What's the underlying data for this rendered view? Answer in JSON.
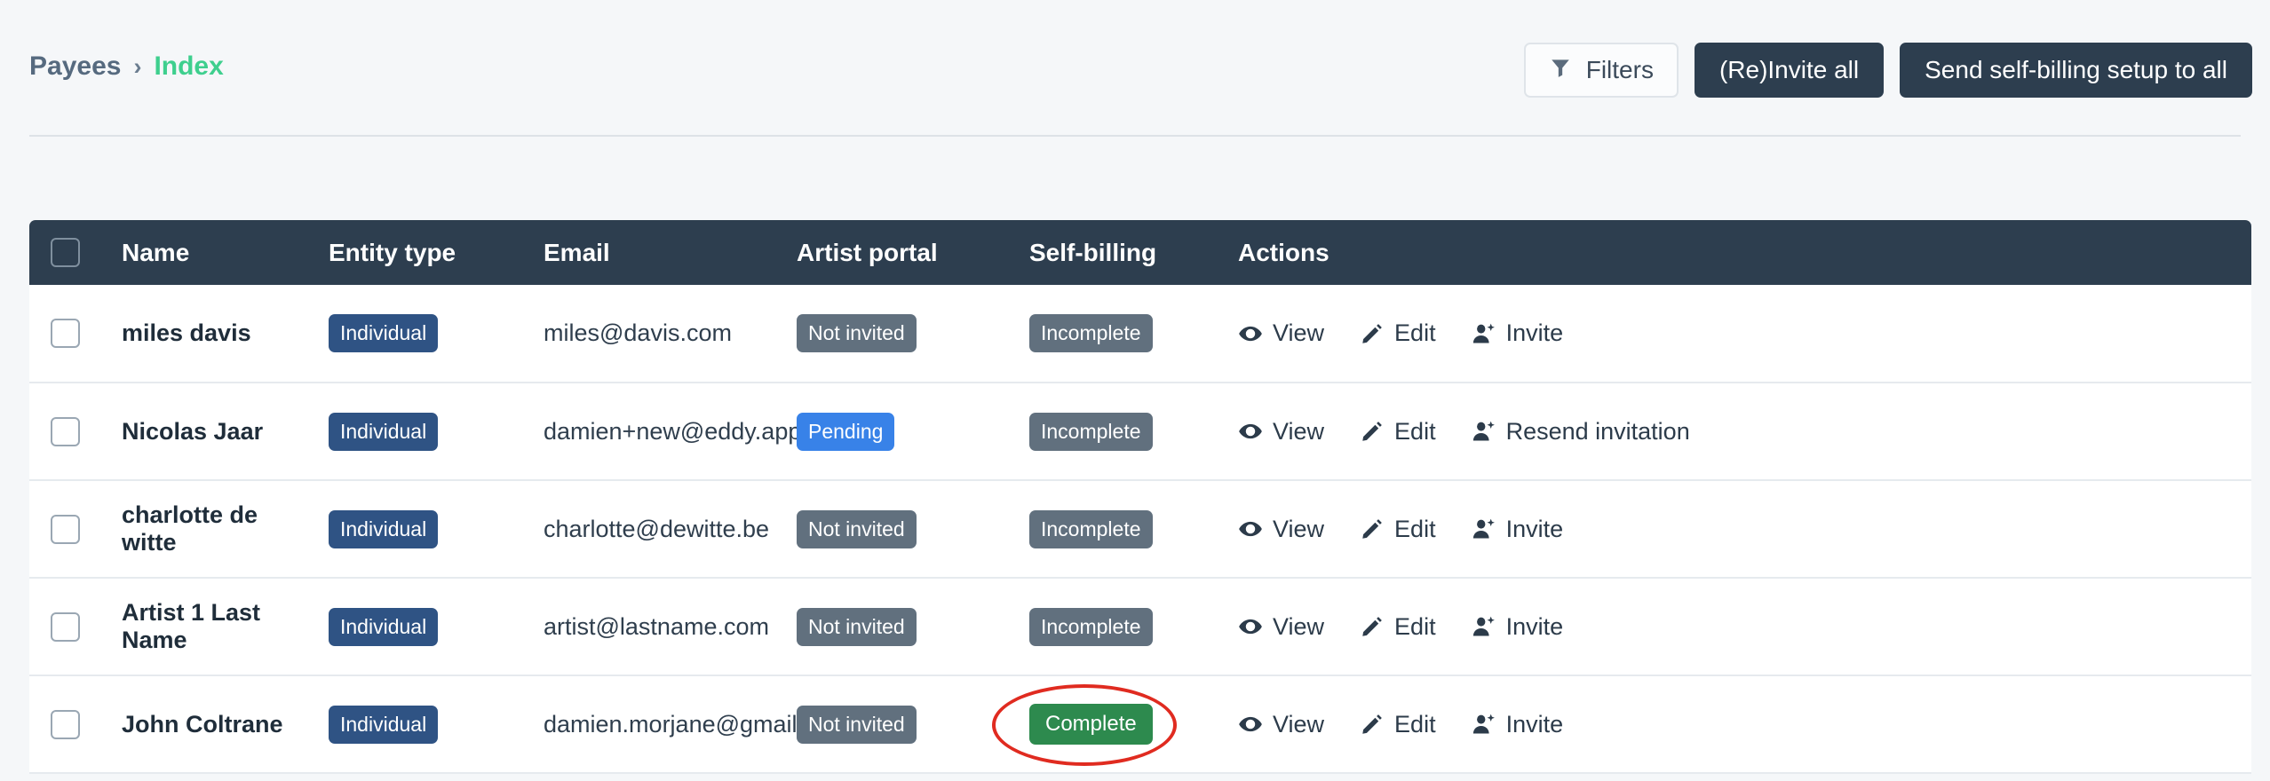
{
  "breadcrumb": {
    "root": "Payees",
    "separator": "›",
    "current": "Index"
  },
  "toolbar": {
    "filters_label": "Filters",
    "filters_icon": "funnel-icon",
    "reinvite_all_label": "(Re)Invite all",
    "send_self_billing_label": "Send self-billing setup to all"
  },
  "colors": {
    "page_background": "#f5f7f9",
    "header_dark": "#2d3e4f",
    "accent_green": "#3ecf8e",
    "badge_individual": "#2f5384",
    "badge_gray": "#61707e",
    "badge_pending": "#3882e8",
    "badge_complete": "#2d8a4e",
    "annotation_red": "#e02b20"
  },
  "table": {
    "select_all_checkbox": false,
    "columns": [
      {
        "key": "select",
        "label": ""
      },
      {
        "key": "name",
        "label": "Name"
      },
      {
        "key": "entity_type",
        "label": "Entity type"
      },
      {
        "key": "email",
        "label": "Email"
      },
      {
        "key": "artist_portal",
        "label": "Artist portal"
      },
      {
        "key": "self_billing",
        "label": "Self-billing"
      },
      {
        "key": "actions",
        "label": "Actions"
      }
    ],
    "rows": [
      {
        "selected": false,
        "name": "miles davis",
        "entity_type": "Individual",
        "email": "miles@davis.com",
        "artist_portal": "Not invited",
        "artist_portal_style": "gray",
        "self_billing": "Incomplete",
        "self_billing_style": "gray",
        "self_billing_annotated": false,
        "actions": [
          {
            "label": "View",
            "icon": "eye-icon"
          },
          {
            "label": "Edit",
            "icon": "pencil-icon"
          },
          {
            "label": "Invite",
            "icon": "user-plus-icon"
          }
        ]
      },
      {
        "selected": false,
        "name": "Nicolas Jaar",
        "entity_type": "Individual",
        "email": "damien+new@eddy.app",
        "artist_portal": "Pending",
        "artist_portal_style": "pending",
        "self_billing": "Incomplete",
        "self_billing_style": "gray",
        "self_billing_annotated": false,
        "actions": [
          {
            "label": "View",
            "icon": "eye-icon"
          },
          {
            "label": "Edit",
            "icon": "pencil-icon"
          },
          {
            "label": "Resend invitation",
            "icon": "user-plus-icon"
          }
        ]
      },
      {
        "selected": false,
        "name": "charlotte de witte",
        "entity_type": "Individual",
        "email": "charlotte@dewitte.be",
        "artist_portal": "Not invited",
        "artist_portal_style": "gray",
        "self_billing": "Incomplete",
        "self_billing_style": "gray",
        "self_billing_annotated": false,
        "actions": [
          {
            "label": "View",
            "icon": "eye-icon"
          },
          {
            "label": "Edit",
            "icon": "pencil-icon"
          },
          {
            "label": "Invite",
            "icon": "user-plus-icon"
          }
        ]
      },
      {
        "selected": false,
        "name": "Artist 1 Last Name",
        "entity_type": "Individual",
        "email": "artist@lastname.com",
        "artist_portal": "Not invited",
        "artist_portal_style": "gray",
        "self_billing": "Incomplete",
        "self_billing_style": "gray",
        "self_billing_annotated": false,
        "actions": [
          {
            "label": "View",
            "icon": "eye-icon"
          },
          {
            "label": "Edit",
            "icon": "pencil-icon"
          },
          {
            "label": "Invite",
            "icon": "user-plus-icon"
          }
        ]
      },
      {
        "selected": false,
        "name": "John Coltrane",
        "entity_type": "Individual",
        "email": "damien.morjane@gmail.com",
        "artist_portal": "Not invited",
        "artist_portal_style": "gray",
        "self_billing": "Complete",
        "self_billing_style": "complete",
        "self_billing_annotated": true,
        "actions": [
          {
            "label": "View",
            "icon": "eye-icon"
          },
          {
            "label": "Edit",
            "icon": "pencil-icon"
          },
          {
            "label": "Invite",
            "icon": "user-plus-icon"
          }
        ]
      }
    ]
  }
}
